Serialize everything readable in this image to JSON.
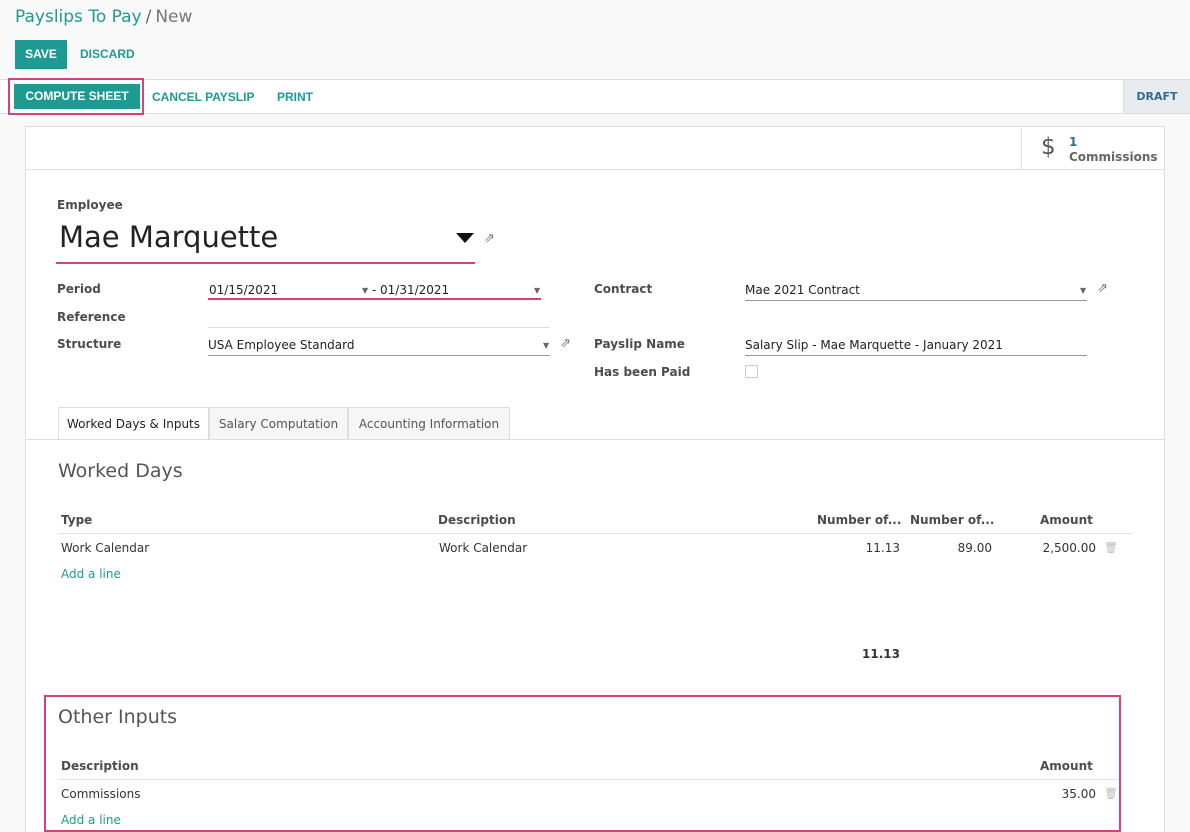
{
  "breadcrumb": {
    "parent": "Payslips To Pay",
    "separator": "/",
    "current": "New"
  },
  "toolbar": {
    "save": "SAVE",
    "discard": "DISCARD"
  },
  "statusbar": {
    "compute": "COMPUTE SHEET",
    "cancel": "CANCEL PAYSLIP",
    "print": "PRINT",
    "state": "DRAFT"
  },
  "smart_button": {
    "icon": "dollar-icon",
    "glyph": "$",
    "value": "1",
    "label": "Commissions"
  },
  "form": {
    "employee_label": "Employee",
    "employee": "Mae Marquette",
    "period_label": "Period",
    "date_from": "01/15/2021",
    "date_sep": "-",
    "date_to": "01/31/2021",
    "reference_label": "Reference",
    "structure_label": "Structure",
    "structure": "USA Employee Standard",
    "contract_label": "Contract",
    "contract": "Mae 2021 Contract",
    "payslip_name_label": "Payslip Name",
    "payslip_name": "Salary Slip - Mae Marquette - January 2021",
    "paid_label": "Has been Paid"
  },
  "tabs": [
    "Worked Days & Inputs",
    "Salary Computation",
    "Accounting Information"
  ],
  "worked_days": {
    "title": "Worked Days",
    "headers": {
      "type": "Type",
      "description": "Description",
      "num1": "Number of...",
      "num2": "Number of...",
      "amount": "Amount"
    },
    "rows": [
      {
        "type": "Work Calendar",
        "description": "Work Calendar",
        "days": "11.13",
        "hours": "89.00",
        "amount": "2,500.00"
      }
    ],
    "add_line": "Add a line",
    "total_days": "11.13"
  },
  "other_inputs": {
    "title": "Other Inputs",
    "headers": {
      "description": "Description",
      "amount": "Amount"
    },
    "rows": [
      {
        "description": "Commissions",
        "amount": "35.00"
      }
    ],
    "add_line": "Add a line"
  },
  "colors": {
    "accent": "#1f9a93",
    "highlight": "#d6407d",
    "state": "#2f6d8c"
  }
}
